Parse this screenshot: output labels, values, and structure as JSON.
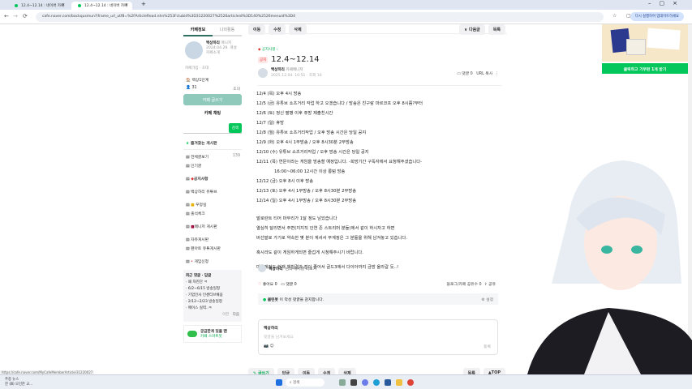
{
  "browser": {
    "tabs": [
      {
        "label": "12.4~12.14 : 네이버 카페"
      },
      {
        "label": "12.4~12.14 : 네이버 카페"
      }
    ],
    "url": "cafe.naver.com/backqusmun?iframe_url_utf8=%2FArticleRead.nhn%253Fclubid%3D31220027%2526articleid%3D140%2526menuid%3D4",
    "signin": "다시 실행하여 업데이트하세요"
  },
  "sidebar": {
    "tabs": [
      "카페정보",
      "나의활동"
    ],
    "cafe_name": "백상하리",
    "cafe_meta": [
      "매니저",
      "2024.04.29. 개설",
      "카페소개"
    ],
    "links": [
      "카페가입",
      "초대"
    ],
    "level": "백상1단계",
    "members": "31",
    "invite": "초대",
    "join_button": "카페 글쓰기",
    "chat": "카페 채팅",
    "search_button": "검색",
    "favorites_title": "즐겨찾는 게시판",
    "menus": [
      "전체글보기",
      "인기글",
      "공지사항",
      "백상하리 유튜브",
      "우정실",
      "출석체크",
      "메니저 게시판",
      "자유게시판",
      "팬아트 유튜게시판",
      "게임신청"
    ],
    "total_count": "139",
    "recent_title": "최근 댓글 · 답글",
    "recent": [
      "왜 자진단 ㅋ",
      "6/2~6/15 방송일정",
      "기업인사 인센티브채움",
      "2/12~2/23 방송일정",
      "메이스 실력..ㅋ"
    ],
    "prev": "이전",
    "next": "다음",
    "promo": [
      "궁금한게 있을 땐",
      "카페 스마트봇"
    ]
  },
  "toolbar": {
    "buttons": [
      "이동",
      "수정",
      "삭제"
    ],
    "next": "다음글",
    "list": "목록"
  },
  "article": {
    "board": "공지사항",
    "badge": "공지",
    "title": "12.4~12.14",
    "author": "백상하리",
    "author_role": "카페매니저",
    "date": "2025.12.04. 10:51 · 조회 10",
    "comments": "댓글 0",
    "url_copy": "URL 복사",
    "lines": [
      "12/4 (목) 오후 4시 방송",
      "12/5 (금) 유튜브 쇼츠거리 작업 하고 오겠습니다 / 방송은 친구랑 마르코프 오후 8시쯤?부터",
      "12/6 (토) 정신 팔병 이후 쥬방 제출친시간",
      "12/7 (일) 휴방",
      "12/8 (월) 유튜브 쇼츠거리작업 / 오후 방송 시간은 당일 공지",
      "12/9 (화) 오후 4시 1부방송 / 오후 8시30분 2부방송",
      "12/10 (수) 유튜브 쇼츠거리작업 / 오후 방송 시간은 당일 공지",
      "12/11 (목) 연문이라는 게임을 방송할 예정입니다. -희망기간 구독자에서 요청해주셨습니다-",
      "        16:00~06:00 12시간 이상 롱텀 방송",
      "12/12 (금) 오후 8시 이후 방송",
      "12/13 (토) 오후 4시 1부방송 / 오후 8시30분 2부방송",
      "12/14 (일) 오후 4시 1부방송 / 오후 8시30분 2부방송"
    ],
    "paragraphs": [
      "발로란트 티어 마무리가 1달 정도 남았습니다",
      "열심히 달리면서 주변(지지직 인연 존 스트리머 분들)에서 같이 하시자고 하면",
      "버선발로 가기로 약속한 몇 분이 계셔서 부계정은 그 분들을 위해 남겨놓고 있습니다.",
      "혹시라도 같이 게임하게되면 즐겁게 시청해주시기 바랍니다.",
      "마검계정도 현재 체험결과 점이 줄어서 골드3에서 다이아까지 금방 올라갈 듯..!"
    ],
    "more_by": "백상하리",
    "more_by_suffix": "님의 게시글 더보기",
    "like": "좋아요 0",
    "comment": "댓글 0",
    "share_count": "블로그/카페 공유수 0",
    "share": "공유",
    "cleanbot": "클린봇",
    "cleanbot_text": "이 악성 댓글을 감지합니다.",
    "settings": "설정",
    "comment_author": "백상하리",
    "comment_placeholder": "댓글을 남겨보세요",
    "submit": "등록"
  },
  "bottombar": {
    "write": "글쓰기",
    "buttons": [
      "답글",
      "이동",
      "수정",
      "삭제"
    ],
    "list": "목록",
    "top": "TOP"
  },
  "ad": {
    "button": "클릭하고 기부펀 1개 받기"
  },
  "statusbar": "https://cafe.naver.com/MyCafeMemberArticle/31220027",
  "taskbar": {
    "weather": "주중 뉴스",
    "weather2": "한 (Ⅲ) 오인한 교...",
    "search": "검색"
  }
}
